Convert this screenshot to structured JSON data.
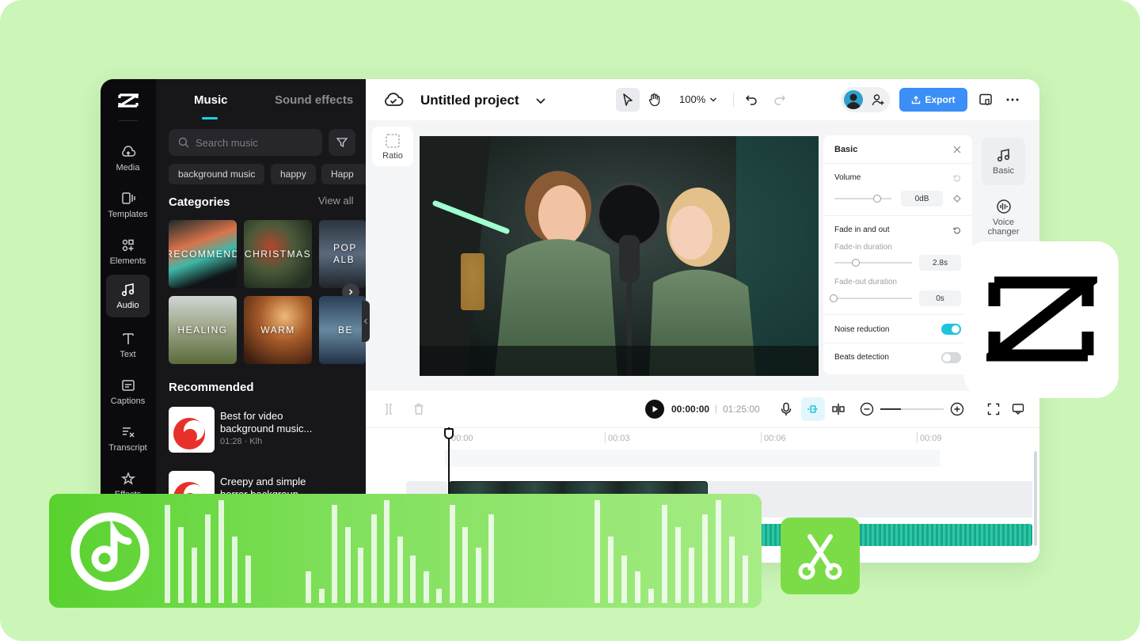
{
  "app": {
    "name": "CapCut"
  },
  "rail": {
    "items": [
      {
        "label": "Media",
        "icon": "cloud-upload-icon"
      },
      {
        "label": "Templates",
        "icon": "templates-icon"
      },
      {
        "label": "Elements",
        "icon": "elements-icon"
      },
      {
        "label": "Audio",
        "icon": "music-note-icon",
        "active": true
      },
      {
        "label": "Text",
        "icon": "text-icon"
      },
      {
        "label": "Captions",
        "icon": "captions-icon"
      },
      {
        "label": "Transcript",
        "icon": "transcript-icon"
      },
      {
        "label": "Effects",
        "icon": "effects-icon"
      }
    ]
  },
  "panel": {
    "tabs": {
      "music": "Music",
      "sound_effects": "Sound effects"
    },
    "search_placeholder": "Search music",
    "chips": [
      "background music",
      "happy",
      "Happ"
    ],
    "categories_title": "Categories",
    "view_all": "View all",
    "categories": [
      {
        "label": "RECOMMEND"
      },
      {
        "label": "CHRISTMAS"
      },
      {
        "label": "POP ALB"
      },
      {
        "label": "HEALING"
      },
      {
        "label": "WARM"
      },
      {
        "label": "BE"
      }
    ],
    "recommended_title": "Recommended",
    "tracks": [
      {
        "title": "Best for video background music...",
        "meta": "01:28 · Klh"
      },
      {
        "title": "Creepy and simple horror backgroun",
        "meta": ""
      }
    ]
  },
  "topbar": {
    "project_title": "Untitled project",
    "zoom": "100%",
    "export_label": "Export"
  },
  "canvas": {
    "ratio_label": "Ratio"
  },
  "props": {
    "header": "Basic",
    "volume_label": "Volume",
    "volume_value": "0dB",
    "fade_label": "Fade in and out",
    "fade_in_label": "Fade-in duration",
    "fade_in_value": "2.8s",
    "fade_out_label": "Fade-out duration",
    "fade_out_value": "0s",
    "noise_label": "Noise reduction",
    "noise_on": true,
    "beats_label": "Beats detection",
    "beats_on": false
  },
  "right_tabs": [
    {
      "label": "Basic",
      "icon": "music-note-icon"
    },
    {
      "label": "Voice changer",
      "icon": "voice-changer-icon"
    }
  ],
  "timeline": {
    "current_time": "00:00:00",
    "separator": "|",
    "duration": "01:25:00",
    "ticks": [
      "00:00",
      "00:03",
      "00:06",
      "00:09"
    ]
  },
  "colors": {
    "accent": "#3b8ff6",
    "toggle_on": "#1fc4dc",
    "background": "#ccf5b8",
    "green": "#58d12e"
  }
}
